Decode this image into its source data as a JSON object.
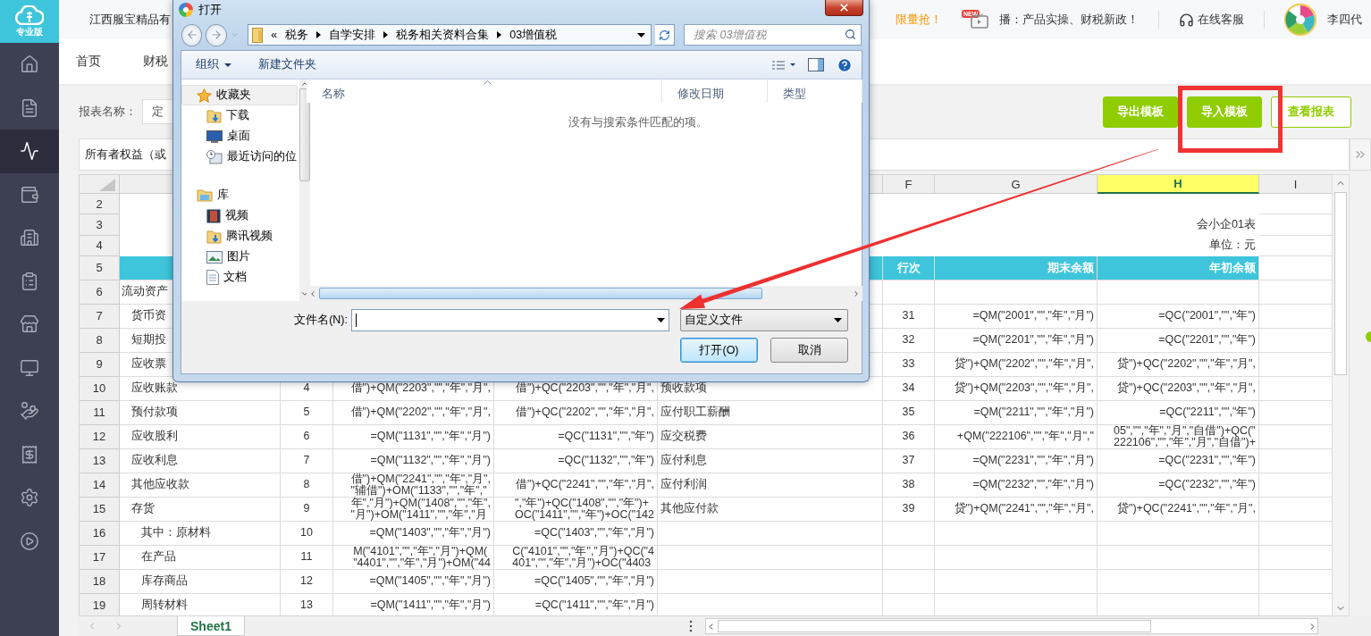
{
  "sidebar": {
    "logo_label": "专业版",
    "items": [
      {
        "selected": false
      },
      {
        "selected": false
      },
      {
        "selected": true
      },
      {
        "selected": false
      },
      {
        "selected": false
      },
      {
        "selected": false
      },
      {
        "selected": false
      },
      {
        "selected": false
      },
      {
        "selected": false
      },
      {
        "selected": false
      },
      {
        "selected": false
      },
      {
        "selected": false
      }
    ]
  },
  "topbar": {
    "company": "江西服宝精品有",
    "promo": "限量抢！",
    "new_badge": "NEW",
    "broadcast": "播：产品实操、财税新政！",
    "support": "在线客服",
    "user": "李四代"
  },
  "nav": {
    "items": [
      {
        "label": "首页"
      },
      {
        "label": "财税"
      }
    ]
  },
  "report_bar": {
    "label": "报表名称：",
    "select_value": "定",
    "buttons": [
      {
        "label": "导出模板",
        "kind": "filled"
      },
      {
        "label": "导入模板",
        "kind": "filled"
      },
      {
        "label": "查看报表",
        "kind": "outline"
      }
    ]
  },
  "formula_bar": {
    "value": "所有者权益（或"
  },
  "sheet": {
    "columns": [
      {
        "label": "F",
        "selected": false
      },
      {
        "label": "G",
        "selected": false
      },
      {
        "label": "H",
        "selected": true
      },
      {
        "label": "I",
        "selected": false
      }
    ],
    "rows": [
      {
        "number": "2",
        "kind": "title",
        "cells": {}
      },
      {
        "number": "3",
        "kind": "title",
        "cells": {
          "H": "会小企01表"
        }
      },
      {
        "number": "4",
        "kind": "title",
        "cells": {
          "H": "单位：元"
        }
      },
      {
        "number": "5",
        "kind": "header",
        "cells": {
          "F": "行次",
          "G": "期末余额",
          "H": "年初余额"
        }
      },
      {
        "number": "6",
        "kind": "section",
        "cells": {
          "A": "流动资产"
        }
      },
      {
        "number": "7",
        "kind": "item",
        "cells": {
          "A": "货币资",
          "F": "31",
          "G": "=QM(\"2001\",\"\",\"年\",\"月\")",
          "H": "=QC(\"2001\",\"\",\"年\")"
        }
      },
      {
        "number": "8",
        "kind": "item",
        "cells": {
          "A": "短期投",
          "F": "32",
          "G": "=QM(\"2201\",\"\",\"年\",\"月\")",
          "H": "=QC(\"2201\",\"\",\"年\")"
        }
      },
      {
        "number": "9",
        "kind": "item",
        "cells": {
          "A": "应收票",
          "F": "33",
          "G": "贷\")+QM(\"2202\",\"\",\"年\",\"月\",",
          "H": "贷\")+QC(\"2202\",\"\",\"年\",\"月\","
        }
      },
      {
        "number": "10",
        "kind": "item",
        "cells": {
          "A": "应收账款",
          "B": "4",
          "C": "借\")+QM(\"2203\",\"\",\"年\",\"月\",",
          "D": "借\")+QC(\"2203\",\"\",\"年\",\"月\",",
          "E": "预收款项",
          "F": "34",
          "G": "贷\")+QM(\"2203\",\"\",\"年\",\"月\",",
          "H": "贷\")+QC(\"2203\",\"\",\"年\",\"月\","
        }
      },
      {
        "number": "11",
        "kind": "item",
        "cells": {
          "A": "预付款项",
          "B": "5",
          "C": "借\")+QM(\"2202\",\"\",\"年\",\"月\",",
          "D": "借\")+QC(\"2202\",\"\",\"年\",\"月\",",
          "E": "应付职工薪酬",
          "F": "35",
          "G": "=QM(\"2211\",\"\",\"年\",\"月\")",
          "H": "=QC(\"2211\",\"\",\"年\")"
        }
      },
      {
        "number": "12",
        "kind": "item",
        "cells": {
          "A": "应收股利",
          "B": "6",
          "C": "=QM(\"1131\",\"\",\"年\",\"月\")",
          "D": "=QC(\"1131\",\"\",\"年\")",
          "E": "应交税费",
          "F": "36",
          "G": "+QM(\"222106\",\"\",\"年\",\"月\",\"",
          "H": "05\",\"\",\"年\",\"月\",\"自借\")+QC(\"\n222106\",\"\",\"年\",\"月\",\"自借\")+"
        }
      },
      {
        "number": "13",
        "kind": "item",
        "cells": {
          "A": "应收利息",
          "B": "7",
          "C": "=QM(\"1132\",\"\",\"年\",\"月\")",
          "D": "=QC(\"1132\",\"\",\"年\")",
          "E": "应付利息",
          "F": "37",
          "G": "=QM(\"2231\",\"\",\"年\",\"月\")",
          "H": "=QC(\"2231\",\"\",\"年\")"
        }
      },
      {
        "number": "14",
        "kind": "item",
        "cells": {
          "A": "其他应收款",
          "B": "8",
          "C": "借\")+QM(\"2241\",\"\",\"年\",\"月\",\n\"辅借\")+OM(\"1133\",\"\",\"年\",\"",
          "D": "借\")+QC(\"2241\",\"\",\"年\",\"月\",",
          "E": "应付利润",
          "F": "38",
          "G": "=QM(\"2232\",\"\",\"年\",\"月\")",
          "H": "=QC(\"2232\",\"\",\"年\")"
        }
      },
      {
        "number": "15",
        "kind": "item",
        "cells": {
          "A": "存货",
          "B": "9",
          "C": "年\",\"月\")+QM(\"1408\",\"\",\"年\",\n\"月\")+OM(\"1411\",\"\",\"年\",\"月",
          "D": "\",\"年\")+QC(\"1408\",\"\",\"年\")+\nOC(\"1411\",\"\",\"年\")+OC(\"142",
          "E": "其他应付款",
          "F": "39",
          "G": "贷\")+QM(\"2241\",\"\",\"年\",\"月\",",
          "H": "贷\")+QC(\"2241\",\"\",\"年\",\"月\","
        }
      },
      {
        "number": "16",
        "kind": "subitem",
        "cells": {
          "A": "其中：原材料",
          "B": "10",
          "C": "=QM(\"1403\",\"\",\"年\",\"月\")",
          "D": "=QC(\"1403\",\"\",\"年\",\"月\")"
        }
      },
      {
        "number": "17",
        "kind": "subitem",
        "cells": {
          "A": "在产品",
          "B": "11",
          "C": "M(\"4101\",\"\",\"年\",\"月\")+QM(\n\"4401\",\"\",\"年\",\"月\")+OM(\"44",
          "D": "C(\"4101\",\"\",\"年\",\"月\")+QC(\"4\n401\",\"\",\"年\",\"月\")+OC(\"4403"
        }
      },
      {
        "number": "18",
        "kind": "subitem",
        "cells": {
          "A": "库存商品",
          "B": "12",
          "C": "=QM(\"1405\",\"\",\"年\",\"月\")",
          "D": "=QC(\"1405\",\"\",\"年\",\"月\")"
        }
      },
      {
        "number": "19",
        "kind": "subitem",
        "cells": {
          "A": "周转材料",
          "B": "13",
          "C": "=QM(\"1411\",\"\",\"年\",\"月\")",
          "D": "=QC(\"1411\",\"\",\"年\",\"月\")"
        }
      }
    ]
  },
  "sheet_tabs": [
    {
      "label": "Sheet1",
      "selected": true
    }
  ],
  "dialog": {
    "title": "打开",
    "path_prefix": "«",
    "path": [
      "税务",
      "自学安排",
      "税务相关资料合集",
      "03增值税"
    ],
    "search_placeholder": "搜索 03增值税",
    "toolbar": {
      "organize": "组织",
      "new_folder": "新建文件夹"
    },
    "nav": [
      {
        "label": "收藏夹",
        "selected": true,
        "children": [
          {
            "label": "下载",
            "selected": false
          },
          {
            "label": "桌面",
            "selected": false
          },
          {
            "label": "最近访问的位",
            "selected": false
          }
        ]
      },
      {
        "label": "库",
        "selected": false,
        "children": [
          {
            "label": "视频",
            "selected": false
          },
          {
            "label": "腾讯视频",
            "selected": false
          },
          {
            "label": "图片",
            "selected": false
          },
          {
            "label": "文档",
            "selected": false
          }
        ]
      }
    ],
    "columns": [
      "名称",
      "修改日期",
      "类型"
    ],
    "empty_message": "没有与搜索条件匹配的项。",
    "filename_label": "文件名(N):",
    "file_type": "自定义文件",
    "buttons": [
      {
        "label": "打开(O)",
        "kind": "default"
      },
      {
        "label": "取消",
        "kind": "normal"
      }
    ]
  }
}
